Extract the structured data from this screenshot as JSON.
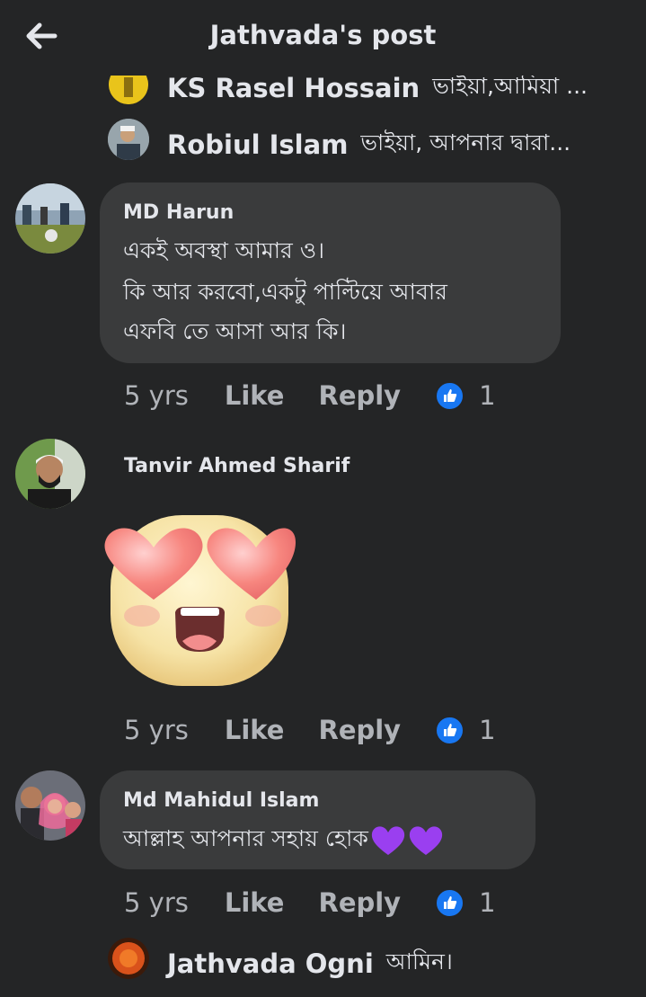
{
  "header": {
    "title": "Jathvada's post",
    "back_icon": "back-arrow-icon"
  },
  "replies_top": [
    {
      "name": "KS Rasel Hossain",
      "text": "ভাইয়া,আমিয়া ..."
    },
    {
      "name": "Robiul Islam",
      "text": "ভাইয়া, আপনার দ্বারা..."
    }
  ],
  "comments": [
    {
      "name": "MD Harun",
      "lines": [
        "একই অবস্থা  আমার ও।",
        "কি আর করবো,একটু পাল্টিয়ে আবার",
        "এফবি তে আসা আর কি।"
      ],
      "time": "5 yrs",
      "like": "Like",
      "reply": "Reply",
      "likes": "1"
    },
    {
      "name": "Tanvir Ahmed Sharif",
      "sticker": "heart-eyes-emoji",
      "time": "5 yrs",
      "like": "Like",
      "reply": "Reply",
      "likes": "1"
    },
    {
      "name": "Md Mahidul Islam",
      "lines": [
        "আল্লাহ আপনার সহায় হোক"
      ],
      "time": "5 yrs",
      "like": "Like",
      "reply": "Reply",
      "likes": "1"
    }
  ],
  "reply_bottom": {
    "name": "Jathvada Ogni",
    "text": "আমিন।"
  },
  "colors": {
    "background": "#242526",
    "bubble": "#3a3b3c",
    "like_blue": "#1877f2",
    "muted": "#b0b3b8"
  }
}
